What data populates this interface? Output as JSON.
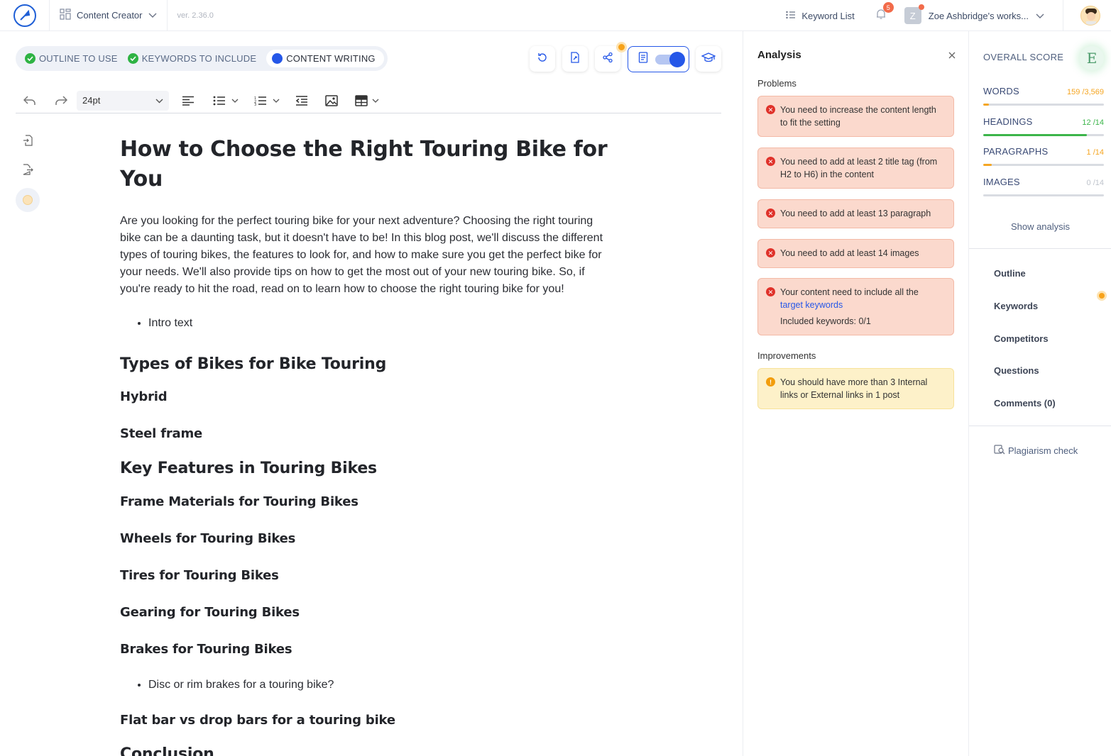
{
  "topbar": {
    "app_name": "Content Creator",
    "version": "ver. 2.36.0",
    "keyword_list": "Keyword List",
    "notifications": "5",
    "workspace_initial": "Z",
    "workspace_name": "Zoe Ashbridge's works..."
  },
  "steps": [
    {
      "label": "OUTLINE TO USE",
      "status": "done"
    },
    {
      "label": "KEYWORDS TO INCLUDE",
      "status": "done"
    },
    {
      "label": "CONTENT WRITING",
      "status": "active"
    }
  ],
  "editor": {
    "font_size": "24pt"
  },
  "document": {
    "title": "How to Choose the Right Touring Bike for You",
    "intro": "Are you looking for the perfect touring bike for your next adventure? Choosing the right touring bike can be a daunting task, but it doesn't have to be! In this blog post, we'll discuss the different types of touring bikes, the features to look for, and how to make sure you get the perfect bike for your needs. We'll also provide tips on how to get the most out of your new touring bike. So, if you're ready to hit the road, read on to learn how to choose the right touring bike for you!",
    "bullet_intro": "Intro text",
    "h2_types": "Types of Bikes for Bike Touring",
    "h3_hybrid": "Hybrid",
    "h3_steel": "Steel frame",
    "h2_features": "Key Features in Touring Bikes",
    "h3_frame": "Frame Materials for Touring Bikes",
    "h3_wheels": "Wheels for Touring Bikes",
    "h3_tires": "Tires for Touring Bikes",
    "h3_gearing": "Gearing for Touring Bikes",
    "h3_brakes": "Brakes for Touring Bikes",
    "bullet_brakes": "Disc or rim brakes for a touring bike?",
    "h3_bars": "Flat bar vs drop bars for a touring bike",
    "h2_conclusion": "Conclusion"
  },
  "analysis": {
    "title": "Analysis",
    "problems_label": "Problems",
    "problems": [
      "You need to increase the content length to fit the setting",
      "You need to add at least 2 title tag (from H2 to H6) in the content",
      "You need to add at least 13 paragraph",
      "You need to add at least 14 images"
    ],
    "keywords_problem_prefix": "Your content need to include all the",
    "keywords_problem_link": "target keywords",
    "keywords_problem_included": "Included keywords: 0/1",
    "improvements_label": "Improvements",
    "improvements": [
      "You should have more than 3 Internal links or External links in 1 post"
    ]
  },
  "score": {
    "overall_label": "OVERALL SCORE",
    "grade": "E",
    "metrics": [
      {
        "label": "WORDS",
        "value": "159 /3,569",
        "fraction": 0.045,
        "color": "#f5a623"
      },
      {
        "label": "HEADINGS",
        "value": "12 /14",
        "fraction": 0.857,
        "color": "#3cb54a"
      },
      {
        "label": "PARAGRAPHS",
        "value": "1 /14",
        "fraction": 0.071,
        "color": "#f5a623"
      },
      {
        "label": "IMAGES",
        "value": "0 /14",
        "fraction": 0,
        "color": "#bfc4cc"
      }
    ],
    "show_analysis": "Show analysis",
    "nav": [
      "Outline",
      "Keywords",
      "Competitors",
      "Questions",
      "Comments (0)"
    ],
    "plagiarism": "Plagiarism check"
  },
  "colors": {
    "accent": "#2557e8",
    "success": "#2fb344",
    "warning": "#f7a21a",
    "error": "#e0322a"
  },
  "icons": [
    "logo-icon",
    "grid-icon",
    "chevron-down-icon",
    "list-icon",
    "bell-icon",
    "undo-icon",
    "redo-icon",
    "align-left-icon",
    "bullet-list-icon",
    "numbered-list-icon",
    "outdent-icon",
    "image-icon",
    "table-icon",
    "history-icon",
    "export-icon",
    "share-icon",
    "document-icon",
    "graduation-cap-icon",
    "import-icon",
    "logout-icon",
    "close-icon",
    "error-icon",
    "warning-icon",
    "plagiarism-icon"
  ]
}
